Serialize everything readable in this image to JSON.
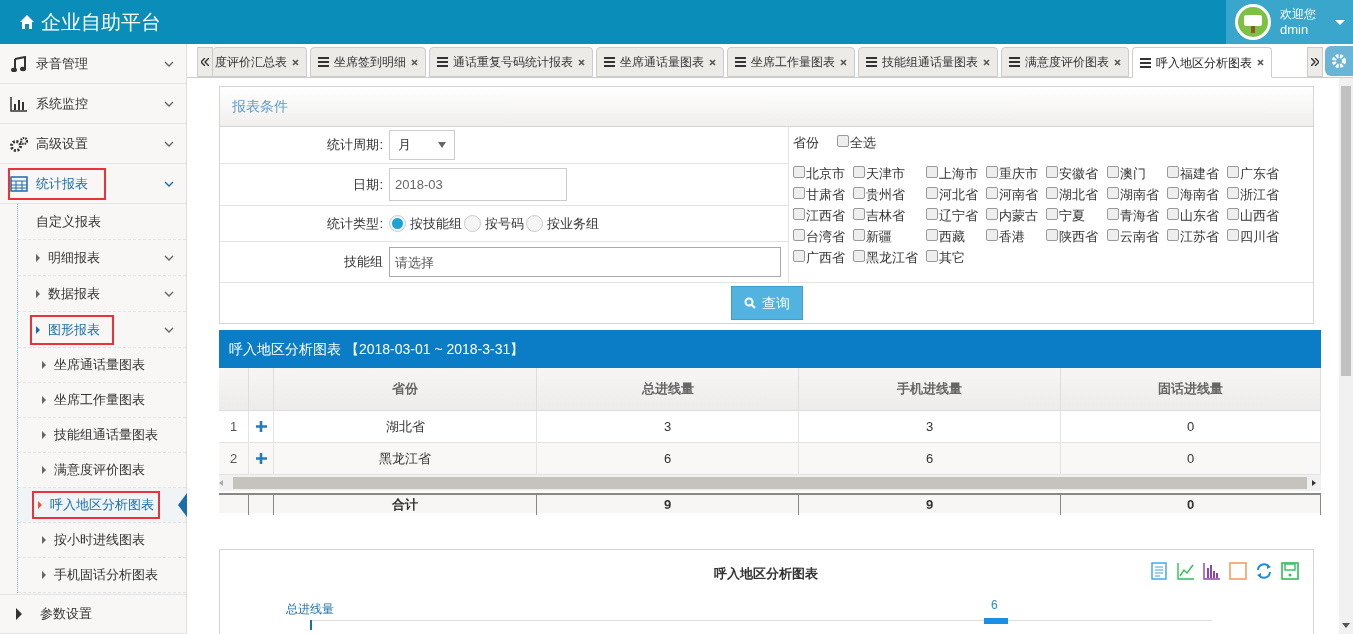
{
  "header": {
    "title": "企业自助平台",
    "user": {
      "greeting": "欢迎您",
      "name": "dmin"
    }
  },
  "sidebar": {
    "items": [
      {
        "label": "录音管理",
        "expanded": false,
        "highlighted": false
      },
      {
        "label": "系统监控",
        "expanded": false,
        "highlighted": false
      },
      {
        "label": "高级设置",
        "expanded": false,
        "highlighted": false
      },
      {
        "label": "统计报表",
        "expanded": true,
        "highlighted": true,
        "children": [
          {
            "label": "自定义报表",
            "expandable": false,
            "expanded": false,
            "highlighted": false
          },
          {
            "label": "明细报表",
            "expandable": true,
            "expanded": false,
            "highlighted": false
          },
          {
            "label": "数据报表",
            "expandable": true,
            "expanded": false,
            "highlighted": false
          },
          {
            "label": "图形报表",
            "expandable": true,
            "expanded": true,
            "highlighted": true,
            "children": [
              {
                "label": "坐席通话量图表",
                "selected": false,
                "highlighted": false
              },
              {
                "label": "坐席工作量图表",
                "selected": false,
                "highlighted": false
              },
              {
                "label": "技能组通话量图表",
                "selected": false,
                "highlighted": false
              },
              {
                "label": "满意度评价图表",
                "selected": false,
                "highlighted": false
              },
              {
                "label": "呼入地区分析图表",
                "selected": true,
                "highlighted": true
              },
              {
                "label": "按小时进线图表",
                "selected": false,
                "highlighted": false
              },
              {
                "label": "手机固话分析图表",
                "selected": false,
                "highlighted": false
              }
            ]
          }
        ]
      },
      {
        "label": "参数设置",
        "expanded": false,
        "highlighted": false
      }
    ]
  },
  "tabs": [
    {
      "label": "度评价汇总表",
      "selected": false
    },
    {
      "label": "坐席签到明细",
      "selected": false
    },
    {
      "label": "通话重复号码统计报表",
      "selected": false
    },
    {
      "label": "坐席通话量图表",
      "selected": false
    },
    {
      "label": "坐席工作量图表",
      "selected": false
    },
    {
      "label": "技能组通话量图表",
      "selected": false
    },
    {
      "label": "满意度评价图表",
      "selected": false
    },
    {
      "label": "呼入地区分析图表",
      "selected": true
    }
  ],
  "conditions": {
    "title": "报表条件",
    "period": {
      "label": "统计周期:",
      "value": "月"
    },
    "date": {
      "label": "日期:",
      "value": "2018-03"
    },
    "type": {
      "label": "统计类型:",
      "options": [
        {
          "label": "按技能组",
          "selected": true
        },
        {
          "label": "按号码",
          "selected": false
        },
        {
          "label": "按业务组",
          "selected": false
        }
      ]
    },
    "skill_group": {
      "label": "技能组",
      "placeholder": "请选择"
    },
    "province": {
      "label": "省份",
      "select_all": {
        "label": "全选",
        "checked": false
      },
      "options": [
        {
          "label": "北京市",
          "checked": false
        },
        {
          "label": "天津市",
          "checked": false
        },
        {
          "label": "上海市",
          "checked": false
        },
        {
          "label": "重庆市",
          "checked": false
        },
        {
          "label": "安徽省",
          "checked": false
        },
        {
          "label": "澳门",
          "checked": false
        },
        {
          "label": "福建省",
          "checked": false
        },
        {
          "label": "广东省",
          "checked": false
        },
        {
          "label": "甘肃省",
          "checked": false
        },
        {
          "label": "贵州省",
          "checked": false
        },
        {
          "label": "河北省",
          "checked": false
        },
        {
          "label": "河南省",
          "checked": false
        },
        {
          "label": "湖北省",
          "checked": false
        },
        {
          "label": "湖南省",
          "checked": false
        },
        {
          "label": "海南省",
          "checked": false
        },
        {
          "label": "浙江省",
          "checked": false
        },
        {
          "label": "江西省",
          "checked": false
        },
        {
          "label": "吉林省",
          "checked": false
        },
        {
          "label": "辽宁省",
          "checked": false
        },
        {
          "label": "内蒙古",
          "checked": false
        },
        {
          "label": "宁夏",
          "checked": false
        },
        {
          "label": "青海省",
          "checked": false
        },
        {
          "label": "山东省",
          "checked": false
        },
        {
          "label": "山西省",
          "checked": false
        },
        {
          "label": "台湾省",
          "checked": false
        },
        {
          "label": "新疆",
          "checked": false
        },
        {
          "label": "西藏",
          "checked": false
        },
        {
          "label": "香港",
          "checked": false
        },
        {
          "label": "陕西省",
          "checked": false
        },
        {
          "label": "云南省",
          "checked": false
        },
        {
          "label": "江苏省",
          "checked": false
        },
        {
          "label": "四川省",
          "checked": false
        },
        {
          "label": "广西省",
          "checked": false
        },
        {
          "label": "黑龙江省",
          "checked": false
        },
        {
          "label": "其它",
          "checked": false
        }
      ]
    },
    "query_button": "查询"
  },
  "grid": {
    "title": "呼入地区分析图表 【2018-03-01 ~ 2018-3-31】",
    "columns": [
      "省份",
      "总进线量",
      "手机进线量",
      "固话进线量"
    ],
    "rows": [
      {
        "index": "1",
        "cells": [
          "湖北省",
          "3",
          "3",
          "0"
        ]
      },
      {
        "index": "2",
        "cells": [
          "黑龙江省",
          "6",
          "6",
          "0"
        ]
      }
    ],
    "footer": [
      "合计",
      "9",
      "9",
      "0"
    ]
  },
  "chart": {
    "title": "呼入地区分析图表",
    "ylabel": "总进线量",
    "bar_label": "6"
  }
}
